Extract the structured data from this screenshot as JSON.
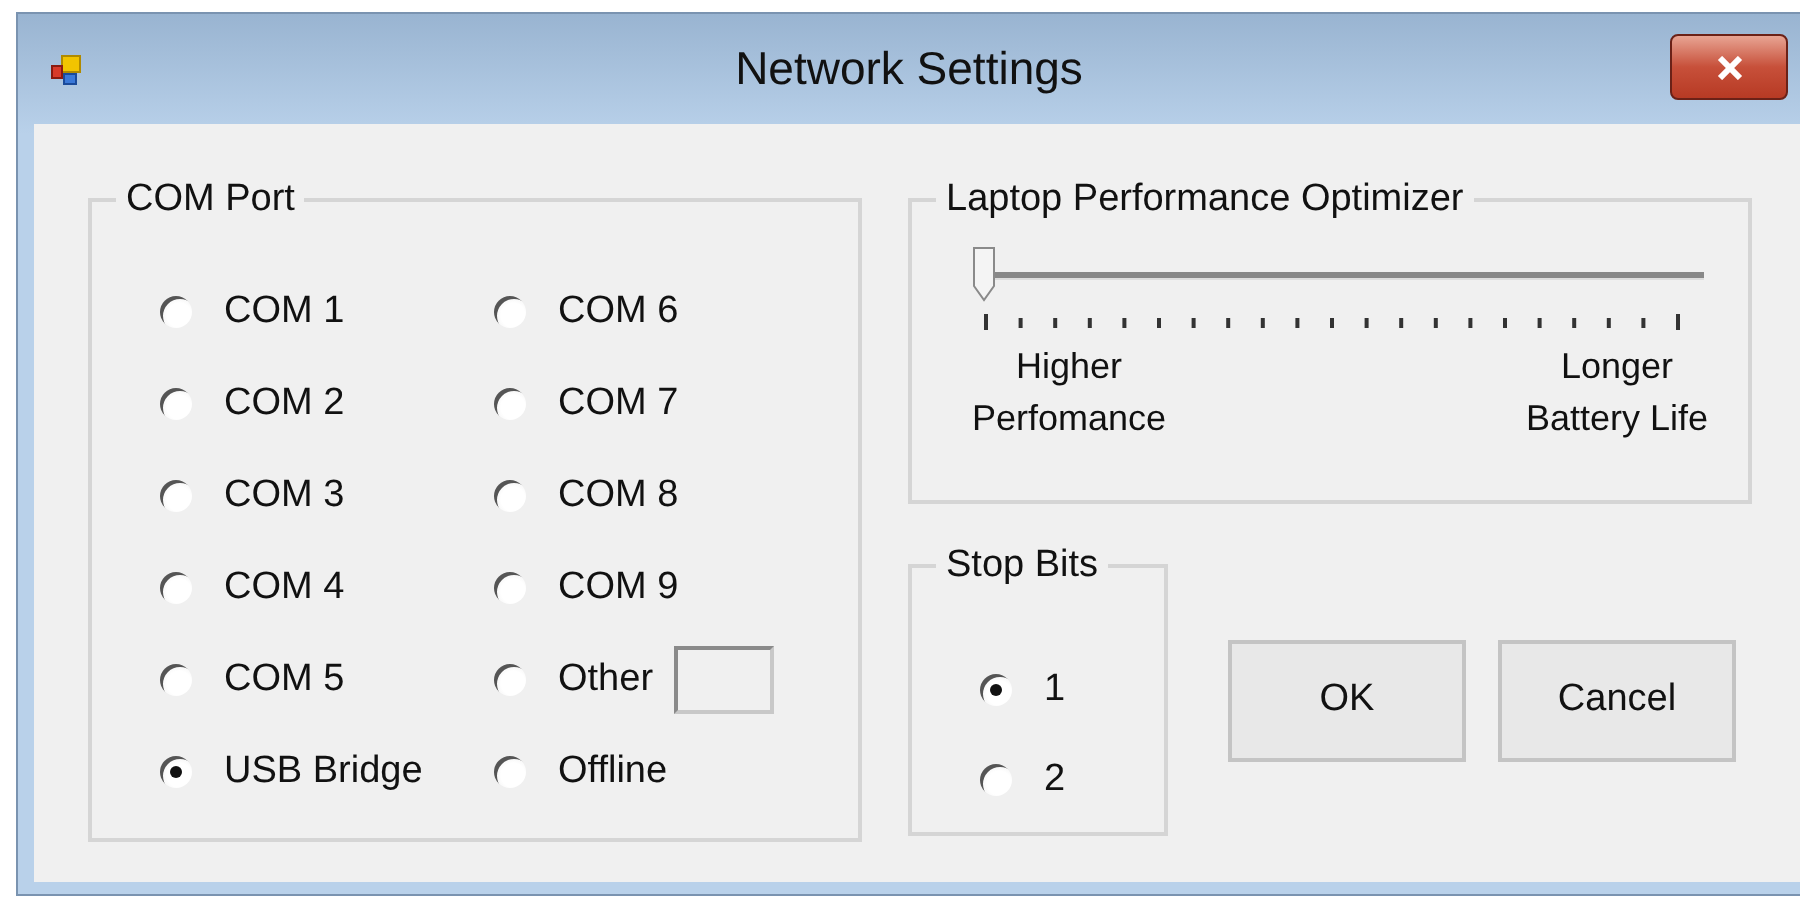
{
  "window": {
    "title": "Network Settings"
  },
  "com_port": {
    "title": "COM Port",
    "options": [
      {
        "label": "COM 1",
        "selected": false,
        "kind": "radio"
      },
      {
        "label": "COM 6",
        "selected": false,
        "kind": "radio"
      },
      {
        "label": "COM 2",
        "selected": false,
        "kind": "radio"
      },
      {
        "label": "COM 7",
        "selected": false,
        "kind": "radio"
      },
      {
        "label": "COM 3",
        "selected": false,
        "kind": "radio"
      },
      {
        "label": "COM 8",
        "selected": false,
        "kind": "radio"
      },
      {
        "label": "COM 4",
        "selected": false,
        "kind": "radio"
      },
      {
        "label": "COM 9",
        "selected": false,
        "kind": "radio"
      },
      {
        "label": "COM 5",
        "selected": false,
        "kind": "radio"
      },
      {
        "label": "Other",
        "selected": false,
        "kind": "radio_with_field"
      },
      {
        "label": "USB Bridge",
        "selected": true,
        "kind": "radio"
      },
      {
        "label": "Offline",
        "selected": false,
        "kind": "radio"
      }
    ]
  },
  "optimizer": {
    "title": "Laptop Performance Optimizer",
    "level": 0,
    "min_label": "Higher\nPerfomance",
    "max_label": "Longer\nBattery Life"
  },
  "stop_bits": {
    "title": "Stop Bits",
    "options": [
      {
        "label": "1",
        "selected": true
      },
      {
        "label": "2",
        "selected": false
      }
    ]
  },
  "buttons": [
    "OK",
    "Cancel"
  ]
}
